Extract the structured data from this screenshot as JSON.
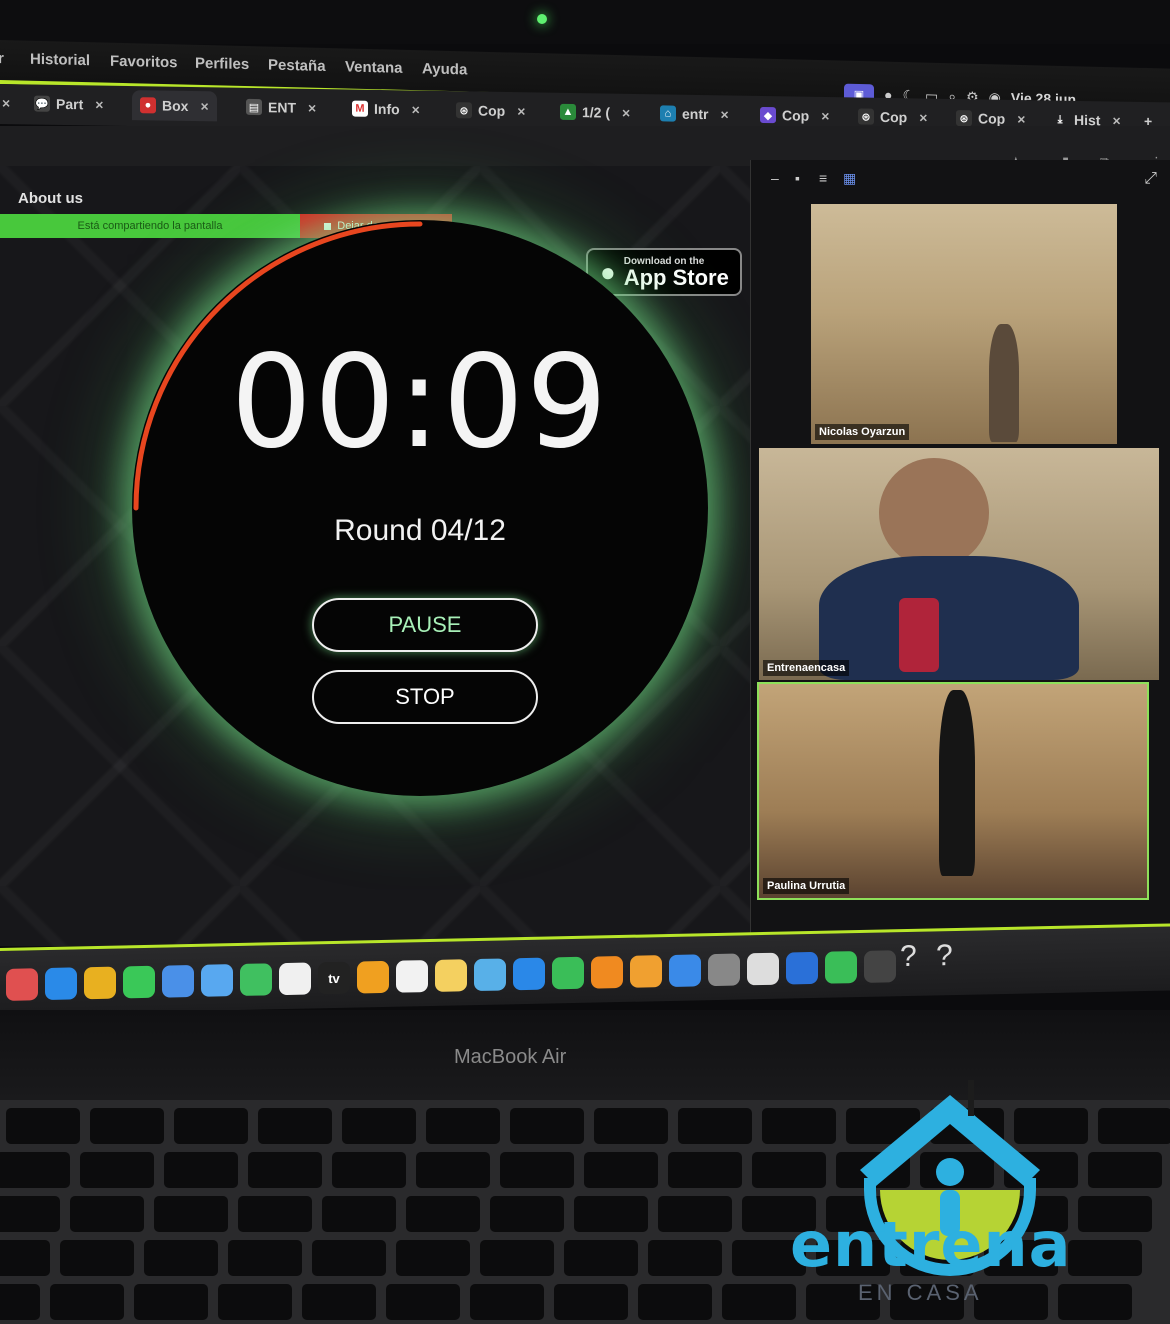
{
  "menubar": {
    "items": [
      "Historial",
      "Favoritos",
      "Perfiles",
      "Pestaña",
      "Ventana",
      "Ayuda"
    ],
    "partial_left": "r",
    "clock": "Vie 28 jun"
  },
  "tabs": [
    {
      "label": "Part",
      "icon": "chat-icon"
    },
    {
      "label": "Box",
      "icon": "box-icon",
      "active": true
    },
    {
      "label": "ENT",
      "icon": "doc-icon"
    },
    {
      "label": "Info",
      "icon": "gmail-icon"
    },
    {
      "label": "Cop",
      "icon": "openai-icon"
    },
    {
      "label": "1/2 (",
      "icon": "drive-icon"
    },
    {
      "label": "entr",
      "icon": "home-icon"
    },
    {
      "label": "Cop",
      "icon": "copilot-icon"
    },
    {
      "label": "Cop",
      "icon": "openai-icon"
    },
    {
      "label": "Cop",
      "icon": "openai-icon"
    },
    {
      "label": "Hist",
      "icon": "download-icon"
    }
  ],
  "page": {
    "about": "About us",
    "share_text": "Está compartiendo la pantalla",
    "stop_share": "Dejar de compartir",
    "appstore_small": "Download on the",
    "appstore_big": "App Store"
  },
  "timer": {
    "time": "00:09",
    "round": "Round 04/12",
    "pause": "PAUSE",
    "stop": "STOP",
    "progress_fraction": 0.25,
    "accent": "#e8461f",
    "glow": "#7be88e"
  },
  "call": {
    "participants": [
      {
        "name": "Nicolas Oyarzun"
      },
      {
        "name": "Entrenaencasa"
      },
      {
        "name": "Paulina Urrutia"
      }
    ]
  },
  "dock": {
    "tv_label": "tv",
    "trailing": [
      "?",
      "?"
    ]
  },
  "laptop_label": "MacBook Air",
  "brand": {
    "name": "entrena",
    "sub": "EN CASA",
    "colors": {
      "blue": "#2db0e0",
      "green": "#b6d334"
    }
  }
}
